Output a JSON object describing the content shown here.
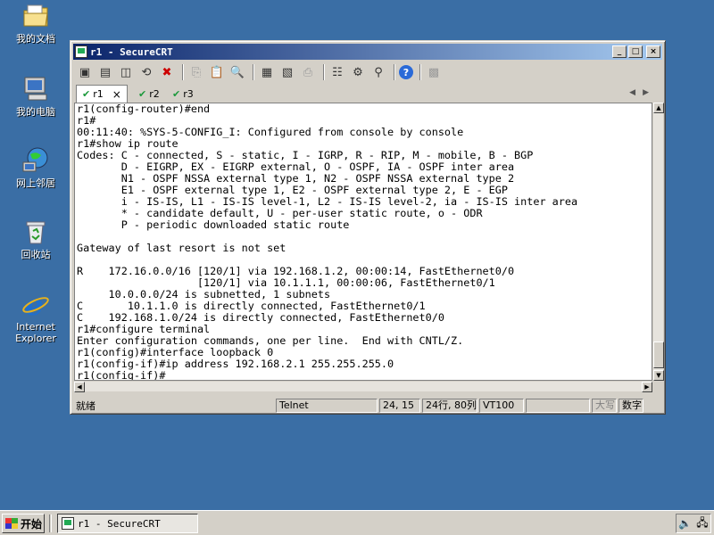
{
  "desktop": {
    "icons": [
      {
        "label": "我的文档",
        "icon": "my-documents-icon"
      },
      {
        "label": "我的电脑",
        "icon": "my-computer-icon"
      },
      {
        "label": "网上邻居",
        "icon": "network-places-icon"
      },
      {
        "label": "回收站",
        "icon": "recycle-bin-icon"
      },
      {
        "label": "Internet Explorer",
        "icon": "internet-explorer-icon"
      }
    ]
  },
  "window": {
    "title": "r1 - SecureCRT",
    "buttons": {
      "minimize": "_",
      "maximize": "□",
      "close": "×"
    }
  },
  "tabs": [
    {
      "label": "r1",
      "active": true,
      "close": "×"
    },
    {
      "label": "r2",
      "active": false
    },
    {
      "label": "r3",
      "active": false
    }
  ],
  "tab_nav": {
    "prev": "◀",
    "next": "▶"
  },
  "terminal": {
    "lines": [
      "r1(config-router)#end",
      "r1#",
      "00:11:40: %SYS-5-CONFIG_I: Configured from console by console",
      "r1#show ip route",
      "Codes: C - connected, S - static, I - IGRP, R - RIP, M - mobile, B - BGP",
      "       D - EIGRP, EX - EIGRP external, O - OSPF, IA - OSPF inter area",
      "       N1 - OSPF NSSA external type 1, N2 - OSPF NSSA external type 2",
      "       E1 - OSPF external type 1, E2 - OSPF external type 2, E - EGP",
      "       i - IS-IS, L1 - IS-IS level-1, L2 - IS-IS level-2, ia - IS-IS inter area",
      "       * - candidate default, U - per-user static route, o - ODR",
      "       P - periodic downloaded static route",
      "",
      "Gateway of last resort is not set",
      "",
      "R    172.16.0.0/16 [120/1] via 192.168.1.2, 00:00:14, FastEthernet0/0",
      "                   [120/1] via 10.1.1.1, 00:00:06, FastEthernet0/1",
      "     10.0.0.0/24 is subnetted, 1 subnets",
      "C       10.1.1.0 is directly connected, FastEthernet0/1",
      "C    192.168.1.0/24 is directly connected, FastEthernet0/0",
      "r1#configure terminal",
      "Enter configuration commands, one per line.  End with CNTL/Z.",
      "r1(config)#interface loopback 0",
      "r1(config-if)#ip address 192.168.2.1 255.255.255.0",
      "r1(config-if)#"
    ]
  },
  "statusbar": {
    "ready": "就绪",
    "protocol": "Telnet",
    "cursor": "24, 15",
    "size": "24行, 80列",
    "emulation": "VT100",
    "caps": "大写",
    "num": "数字"
  },
  "taskbar": {
    "start_label": "开始",
    "task_title": "r1 - SecureCRT"
  }
}
